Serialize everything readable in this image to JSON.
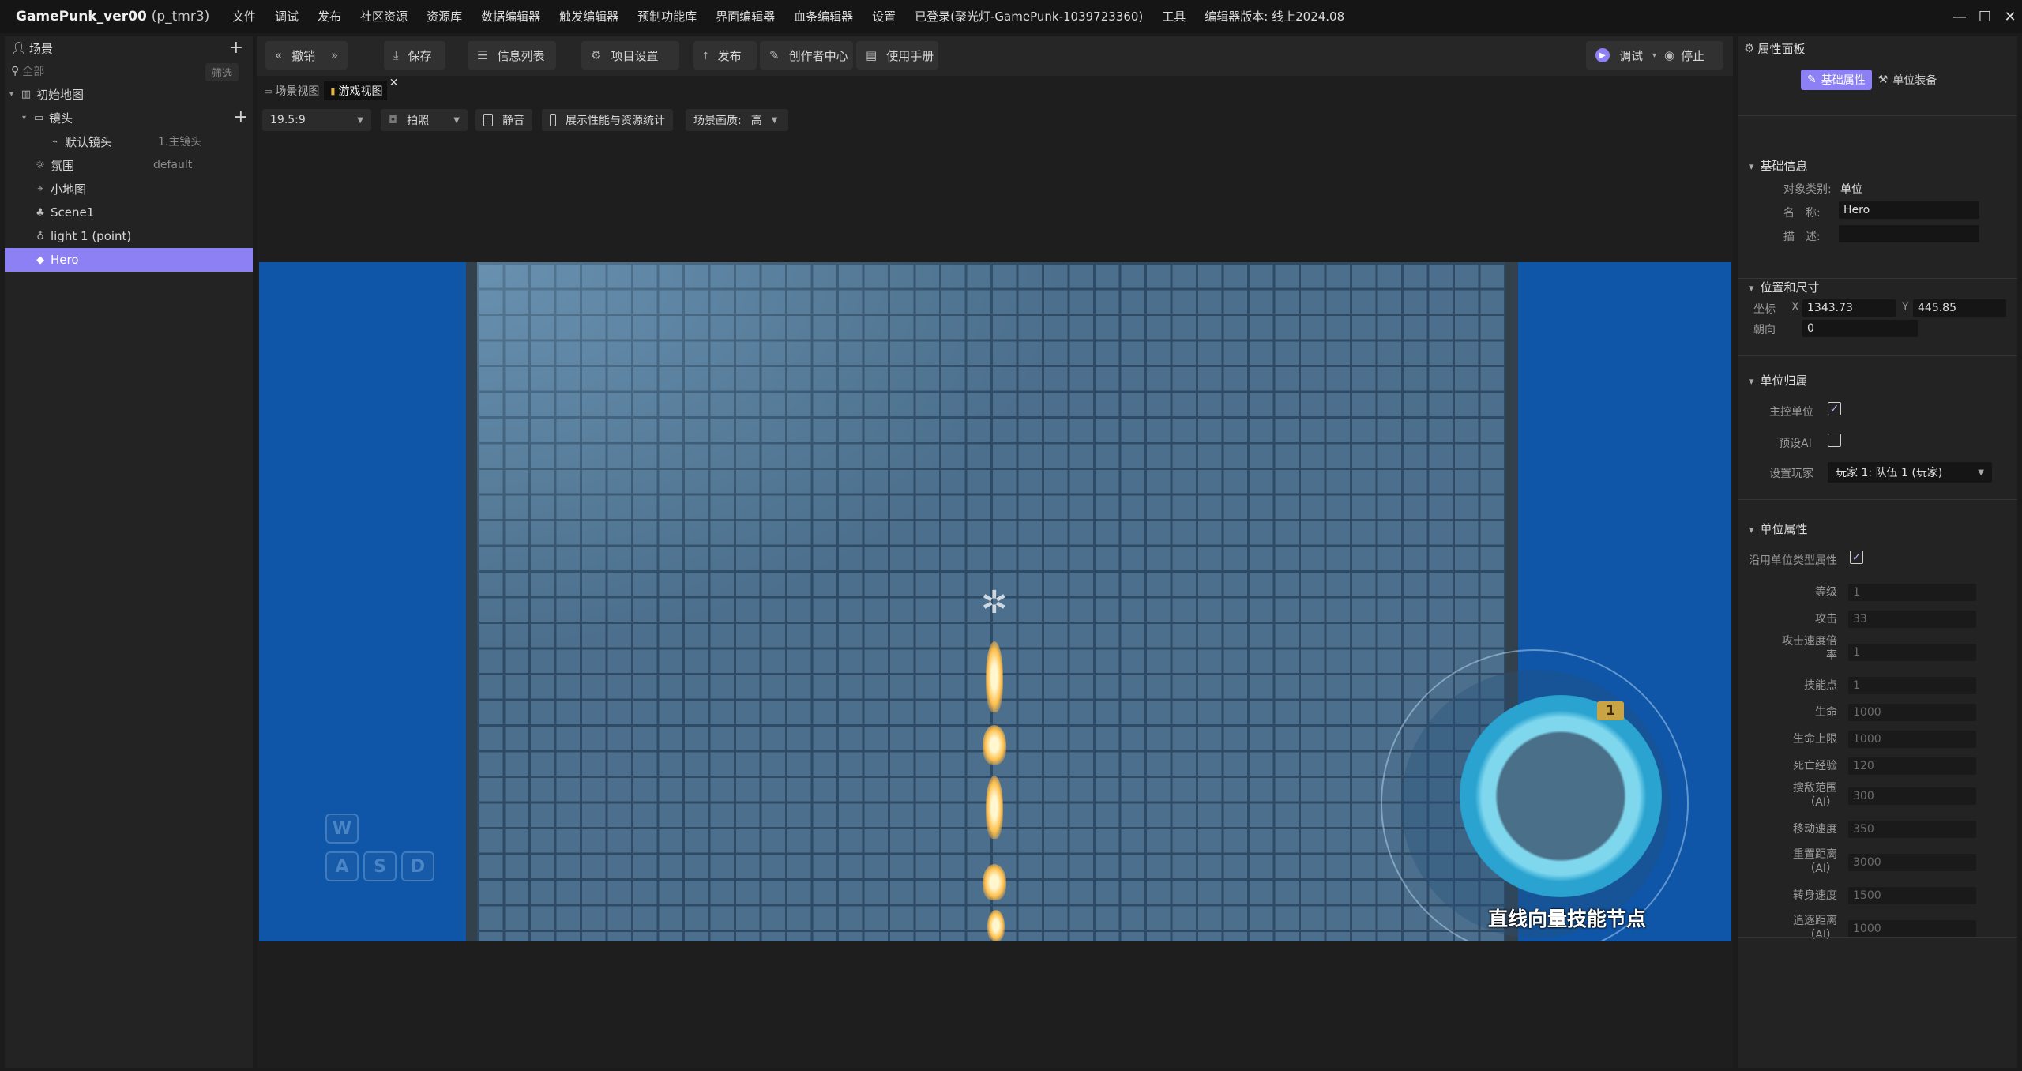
{
  "app": {
    "name": "GamePunk_ver00",
    "project": "(p_tmr3)"
  },
  "menu": [
    "文件",
    "调试",
    "发布",
    "社区资源",
    "资源库",
    "数据编辑器",
    "触发编辑器",
    "预制功能库",
    "界面编辑器",
    "血条编辑器",
    "设置",
    "已登录(聚光灯-GamePunk-1039723360)",
    "工具",
    "编辑器版本: 线上2024.08"
  ],
  "window_controls": {
    "minimize": "—",
    "maximize": "☐",
    "close": "✕"
  },
  "scene_panel": {
    "title": "场景",
    "search_placeholder": "全部",
    "filter_label": "筛选",
    "tree": [
      {
        "label": "初始地图",
        "extra": ""
      },
      {
        "label": "镜头",
        "extra": ""
      },
      {
        "label": "默认镜头",
        "extra": "1.主镜头"
      },
      {
        "label": "氛围",
        "extra": "default"
      },
      {
        "label": "小地图",
        "extra": ""
      },
      {
        "label": "Scene1",
        "extra": ""
      },
      {
        "label": "light 1 (point)",
        "extra": ""
      },
      {
        "label": "Hero",
        "extra": ""
      }
    ]
  },
  "toolbar": {
    "undo": "撤销",
    "save": "保存",
    "info_list": "信息列表",
    "project_settings": "项目设置",
    "publish": "发布",
    "creator_center": "创作者中心",
    "manual": "使用手册",
    "debug": "调试",
    "stop": "停止"
  },
  "view_tabs": {
    "scene_view": "场景视图",
    "game_view": "游戏视图"
  },
  "view_options": {
    "ratio": "19.5:9",
    "photo": "拍照",
    "mute": "静音",
    "show_stats": "展示性能与资源统计",
    "quality_label": "场景画质:",
    "quality_value": "高"
  },
  "game": {
    "keys": [
      "W",
      "A",
      "S",
      "D"
    ],
    "joystick_badge": "1",
    "skill_label": "直线向量技能节点"
  },
  "property_panel": {
    "title": "属性面板",
    "tab_basic": "基础属性",
    "tab_equip": "单位装备",
    "basic_info": {
      "title": "基础信息",
      "type_label": "对象类别:",
      "type_value": "单位",
      "name_label": "名　称:",
      "name_value": "Hero",
      "desc_label": "描　述:",
      "desc_value": ""
    },
    "position": {
      "title": "位置和尺寸",
      "coord_label": "坐标",
      "x_label": "X",
      "x_value": "1343.73",
      "y_label": "Y",
      "y_value": "445.85",
      "facing_label": "朝向",
      "facing_value": "0"
    },
    "ownership": {
      "title": "单位归属",
      "main_unit_label": "主控单位",
      "main_unit_checked": true,
      "preset_ai_label": "预设AI",
      "preset_ai_checked": false,
      "player_label": "设置玩家",
      "player_value": "玩家 1: 队伍 1 (玩家)"
    },
    "unit_props": {
      "title": "单位属性",
      "inherit_label": "沿用单位类型属性",
      "inherit_checked": true,
      "rows": [
        {
          "label": "等级",
          "value": "1"
        },
        {
          "label": "攻击",
          "value": "33"
        },
        {
          "label": "攻击速度倍率",
          "value": "1"
        },
        {
          "label": "技能点",
          "value": "1"
        },
        {
          "label": "生命",
          "value": "1000"
        },
        {
          "label": "生命上限",
          "value": "1000"
        },
        {
          "label": "死亡经验",
          "value": "120"
        },
        {
          "label": "搜敌范围（AI）",
          "value": "300"
        },
        {
          "label": "移动速度",
          "value": "350"
        },
        {
          "label": "重置距离（AI）",
          "value": "3000"
        },
        {
          "label": "转身速度",
          "value": "1500"
        },
        {
          "label": "追逐距离（AI）",
          "value": "1000"
        }
      ]
    }
  },
  "colors": {
    "accent": "#8d80f4",
    "viewport_bg": "#0f55a8",
    "panel_bg": "#232323"
  },
  "icons": [
    "person-icon",
    "search-icon",
    "map-icon",
    "camera-icon",
    "atmosphere-icon",
    "minimap-icon",
    "scene-icon",
    "light-icon",
    "cube-icon",
    "undo-icon",
    "redo-icon",
    "save-icon",
    "list-icon",
    "gear-icon",
    "publish-icon",
    "edit-icon",
    "book-icon",
    "play-icon",
    "stop-icon"
  ]
}
